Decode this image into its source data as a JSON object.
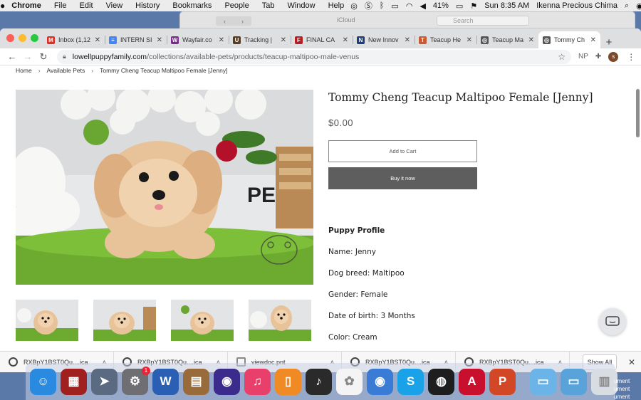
{
  "menubar": {
    "app": "Chrome",
    "items": [
      "File",
      "Edit",
      "View",
      "History",
      "Bookmarks",
      "People",
      "Tab",
      "Window",
      "Help"
    ],
    "battery": "41%",
    "clock": "Sun 8:35 AM",
    "user": "Ikenna Precious Chima"
  },
  "bg_window": {
    "title": "iCloud",
    "search": "Search"
  },
  "tabs": [
    {
      "label": "Inbox (1,12",
      "icon": "gmail-icon",
      "color": "#d93025",
      "glyph": "M"
    },
    {
      "label": "INTERN SI",
      "icon": "docs-icon",
      "color": "#4285f4",
      "glyph": "≡"
    },
    {
      "label": "Wayfair.co",
      "icon": "wayfair-icon",
      "color": "#7b2a8e",
      "glyph": "W"
    },
    {
      "label": "Tracking |",
      "icon": "ups-icon",
      "color": "#5c3a1e",
      "glyph": "U"
    },
    {
      "label": "FINAL CA",
      "icon": "shield-icon",
      "color": "#b21f24",
      "glyph": "F"
    },
    {
      "label": "New Innov",
      "icon": "news-icon",
      "color": "#1d3d7a",
      "glyph": "N"
    },
    {
      "label": "Teacup He",
      "icon": "puppy-icon",
      "color": "#c85a36",
      "glyph": "T"
    },
    {
      "label": "Teacup Ma",
      "icon": "globe-icon",
      "color": "#555555",
      "glyph": "◎"
    },
    {
      "label": "Tommy Ch",
      "icon": "globe-icon",
      "color": "#555555",
      "glyph": "◎",
      "active": true
    }
  ],
  "toolbar": {
    "url_host": "lowellpuppyfamily.com",
    "url_path": "/collections/available-pets/products/teacup-maltipoo-male-venus",
    "ext_label": "NP",
    "profile_initial": "s"
  },
  "breadcrumb": {
    "home": "Home",
    "section": "Available Pets",
    "current": "Tommy Cheng Teacup Maltipoo Female [Jenny]"
  },
  "product": {
    "title": "Tommy Cheng Teacup Maltipoo Female [Jenny]",
    "price": "$0.00",
    "add_to_cart": "Add to Cart",
    "buy_now": "Buy it now",
    "profile_heading": "Puppy Profile",
    "profile_lines": [
      "Name: Jenny",
      "Dog breed: Maltipoo",
      "Gender: Female",
      "Date of birth: 3 Months",
      "Color: Cream"
    ]
  },
  "downloads": {
    "items": [
      "RXBpY1BST0Qu....ica",
      "RXBpY1BST0Qu....ica",
      "viewdoc.pnt",
      "RXBpY1BST0Qu....ica",
      "RXBpY1BST0Qu....ica"
    ],
    "show_all": "Show All"
  },
  "dock": {
    "apps": [
      {
        "name": "finder-icon",
        "color": "#2a8ae0",
        "glyph": "☺"
      },
      {
        "name": "photo-booth-icon",
        "color": "#a02020",
        "glyph": "▦"
      },
      {
        "name": "launchpad-icon",
        "color": "#5a6a80",
        "glyph": "➤"
      },
      {
        "name": "system-preferences-icon",
        "color": "#6e6e73",
        "glyph": "⚙",
        "badge": "1"
      },
      {
        "name": "word-icon",
        "color": "#2b5fb3",
        "glyph": "W"
      },
      {
        "name": "notefile-icon",
        "color": "#9a6b3a",
        "glyph": "▤"
      },
      {
        "name": "siri-icon",
        "color": "#3b2b8c",
        "glyph": "◉"
      },
      {
        "name": "itunes-icon",
        "color": "#e8406a",
        "glyph": "♫"
      },
      {
        "name": "ibooks-icon",
        "color": "#f08a24",
        "glyph": "▯"
      },
      {
        "name": "garageband-icon",
        "color": "#2a2a2a",
        "glyph": "♪"
      },
      {
        "name": "photos-icon",
        "color": "#f4f4f4",
        "glyph": "✿"
      },
      {
        "name": "chrome-icon",
        "color": "#3a7bd5",
        "glyph": "◉"
      },
      {
        "name": "skype-icon",
        "color": "#1aa2e8",
        "glyph": "S"
      },
      {
        "name": "activity-monitor-icon",
        "color": "#1e1e1e",
        "glyph": "◍"
      },
      {
        "name": "acrobat-icon",
        "color": "#c8102e",
        "glyph": "A"
      },
      {
        "name": "powerpoint-icon",
        "color": "#d24726",
        "glyph": "P"
      }
    ],
    "stack": [
      {
        "name": "folder-icon",
        "color": "#6cb4e8",
        "glyph": "▭"
      },
      {
        "name": "downloads-folder-icon",
        "color": "#5aa3da",
        "glyph": "▭"
      },
      {
        "name": "trash-icon",
        "color": "#d8dde4",
        "glyph": "▥"
      }
    ],
    "desktop_labels": [
      "ument",
      "ument",
      "ument"
    ]
  }
}
